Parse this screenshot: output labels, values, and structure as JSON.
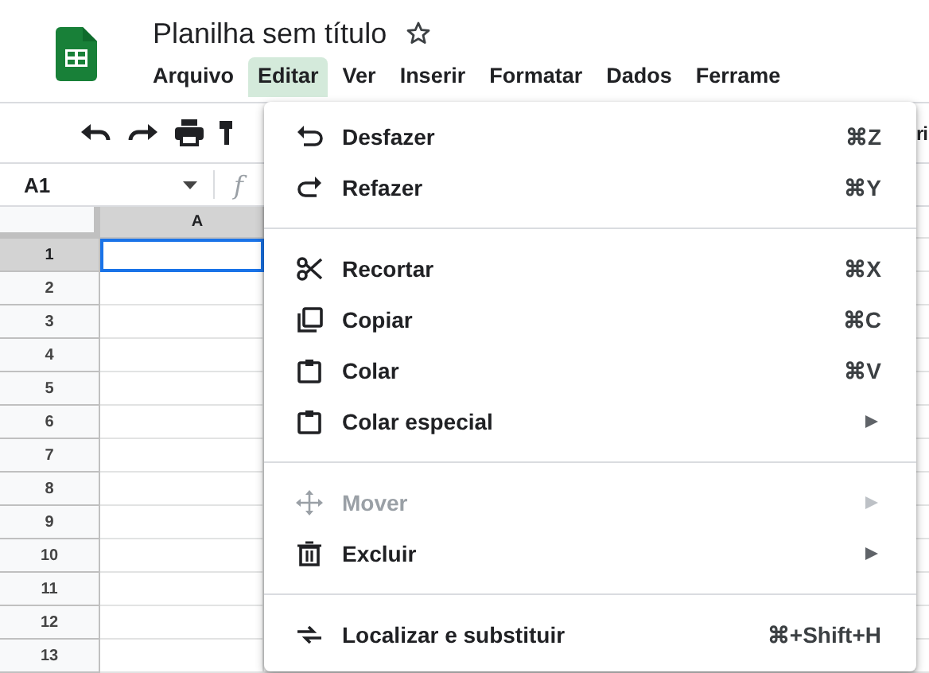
{
  "document": {
    "title": "Planilha sem título",
    "starred": false
  },
  "menu_bar": [
    {
      "label": "Arquivo",
      "selected": false
    },
    {
      "label": "Editar",
      "selected": true
    },
    {
      "label": "Ver",
      "selected": false
    },
    {
      "label": "Inserir",
      "selected": false
    },
    {
      "label": "Formatar",
      "selected": false
    },
    {
      "label": "Dados",
      "selected": false
    },
    {
      "label": "Ferrame",
      "selected": false
    }
  ],
  "toolbar": {
    "font_fragment": "ri"
  },
  "formula_bar": {
    "cell_ref": "A1",
    "fx_fragment": "f"
  },
  "grid": {
    "columns": [
      {
        "label": "A",
        "selected": true
      }
    ],
    "rows": [
      {
        "label": "1",
        "selected": true
      },
      {
        "label": "2",
        "selected": false
      },
      {
        "label": "3",
        "selected": false
      },
      {
        "label": "4",
        "selected": false
      },
      {
        "label": "5",
        "selected": false
      },
      {
        "label": "6",
        "selected": false
      },
      {
        "label": "7",
        "selected": false
      },
      {
        "label": "8",
        "selected": false
      },
      {
        "label": "9",
        "selected": false
      },
      {
        "label": "10",
        "selected": false
      },
      {
        "label": "11",
        "selected": false
      },
      {
        "label": "12",
        "selected": false
      },
      {
        "label": "13",
        "selected": false
      }
    ]
  },
  "edit_menu": [
    {
      "kind": "item",
      "label": "Desfazer",
      "shortcut": "⌘Z",
      "submenu": false,
      "disabled": false
    },
    {
      "kind": "item",
      "label": "Refazer",
      "shortcut": "⌘Y",
      "submenu": false,
      "disabled": false
    },
    {
      "kind": "separator"
    },
    {
      "kind": "item",
      "label": "Recortar",
      "shortcut": "⌘X",
      "submenu": false,
      "disabled": false
    },
    {
      "kind": "item",
      "label": "Copiar",
      "shortcut": "⌘C",
      "submenu": false,
      "disabled": false
    },
    {
      "kind": "item",
      "label": "Colar",
      "shortcut": "⌘V",
      "submenu": false,
      "disabled": false
    },
    {
      "kind": "item",
      "label": "Colar especial",
      "submenu": true,
      "disabled": false
    },
    {
      "kind": "separator"
    },
    {
      "kind": "item",
      "label": "Mover",
      "submenu": true,
      "disabled": true
    },
    {
      "kind": "item",
      "label": "Excluir",
      "submenu": true,
      "disabled": false
    },
    {
      "kind": "separator"
    },
    {
      "kind": "item",
      "label": "Localizar e substituir",
      "shortcut": "⌘+Shift+H",
      "submenu": false,
      "disabled": false
    }
  ]
}
